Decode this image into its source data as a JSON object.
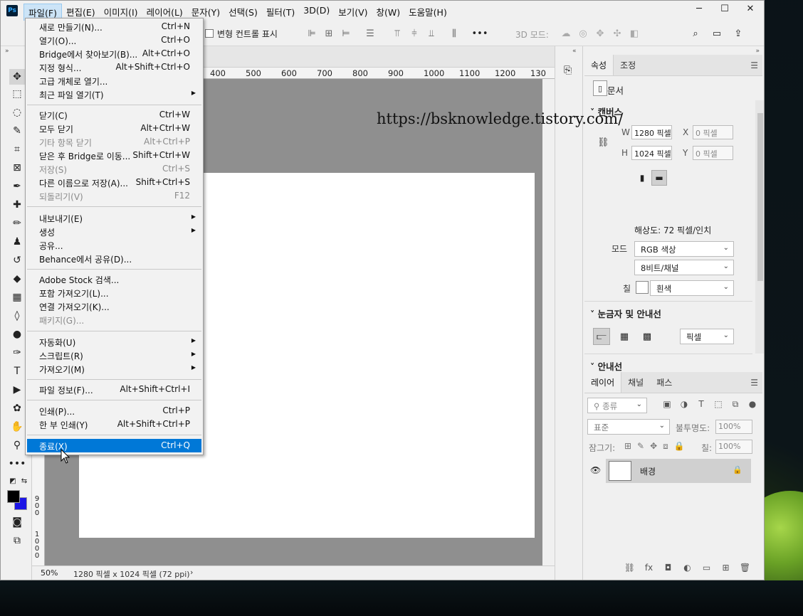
{
  "app": {
    "logo": "Ps"
  },
  "menubar": {
    "items": [
      "파일(F)",
      "편집(E)",
      "이미지(I)",
      "레이어(L)",
      "문자(Y)",
      "선택(S)",
      "필터(T)",
      "3D(D)",
      "보기(V)",
      "창(W)",
      "도움말(H)"
    ]
  },
  "window_controls": {
    "minimize": "─",
    "maximize": "☐",
    "close": "✕"
  },
  "options": {
    "transform_label": "변형 컨트롤 표시",
    "mode_3d": "3D 모드:"
  },
  "file_menu": {
    "items": [
      {
        "label": "새로 만들기(N)...",
        "shortcut": "Ctrl+N"
      },
      {
        "label": "열기(O)...",
        "shortcut": "Ctrl+O"
      },
      {
        "label": "Bridge에서 찾아보기(B)...",
        "shortcut": "Alt+Ctrl+O"
      },
      {
        "label": "지정 형식...",
        "shortcut": "Alt+Shift+Ctrl+O"
      },
      {
        "label": "고급 개체로 열기...",
        "shortcut": ""
      },
      {
        "label": "최근 파일 열기(T)",
        "shortcut": ""
      },
      {
        "label": "닫기(C)",
        "shortcut": "Ctrl+W"
      },
      {
        "label": "모두 닫기",
        "shortcut": "Alt+Ctrl+W"
      },
      {
        "label": "기타 항목 닫기",
        "shortcut": "Alt+Ctrl+P"
      },
      {
        "label": "닫은 후 Bridge로 이동...",
        "shortcut": "Shift+Ctrl+W"
      },
      {
        "label": "저장(S)",
        "shortcut": "Ctrl+S"
      },
      {
        "label": "다른 이름으로 저장(A)...",
        "shortcut": "Shift+Ctrl+S"
      },
      {
        "label": "되돌리기(V)",
        "shortcut": "F12"
      },
      {
        "label": "내보내기(E)",
        "shortcut": ""
      },
      {
        "label": "생성",
        "shortcut": ""
      },
      {
        "label": "공유...",
        "shortcut": ""
      },
      {
        "label": "Behance에서 공유(D)...",
        "shortcut": ""
      },
      {
        "label": "Adobe Stock 검색...",
        "shortcut": ""
      },
      {
        "label": "포함 가져오기(L)...",
        "shortcut": ""
      },
      {
        "label": "연결 가져오기(K)...",
        "shortcut": ""
      },
      {
        "label": "패키지(G)...",
        "shortcut": ""
      },
      {
        "label": "자동화(U)",
        "shortcut": ""
      },
      {
        "label": "스크립트(R)",
        "shortcut": ""
      },
      {
        "label": "가져오기(M)",
        "shortcut": ""
      },
      {
        "label": "파일 정보(F)...",
        "shortcut": "Alt+Shift+Ctrl+I"
      },
      {
        "label": "인쇄(P)...",
        "shortcut": "Ctrl+P"
      },
      {
        "label": "한 부 인쇄(Y)",
        "shortcut": "Alt+Shift+Ctrl+P"
      },
      {
        "label": "종료(X)",
        "shortcut": "Ctrl+Q"
      }
    ]
  },
  "ruler": {
    "h": [
      "400",
      "500",
      "600",
      "700",
      "800",
      "900",
      "1000",
      "1100",
      "1200",
      "130"
    ],
    "v": [
      "9",
      "0",
      "0",
      "1",
      "0",
      "0",
      "0",
      "1",
      "1",
      "0",
      "0"
    ]
  },
  "watermark": "https://bsknowledge.tistory.com/",
  "status": {
    "zoom": "50%",
    "info": "1280 픽셀 x 1024 픽셀 (72 ppi)",
    "arrow": "›"
  },
  "properties": {
    "tabs": [
      "속성",
      "조정"
    ],
    "doc_label": "문서",
    "canvas_title": "캔버스",
    "w_label": "W",
    "w_value": "1280 픽셀",
    "h_label": "H",
    "h_value": "1024 픽셀",
    "x_label": "X",
    "x_value": "0 픽셀",
    "y_label": "Y",
    "y_value": "0 픽셀",
    "resolution": "해상도: 72 픽셀/인치",
    "mode_label": "모드",
    "mode_value": "RGB 색상",
    "depth_value": "8비트/채널",
    "fill_label": "칠",
    "fill_value": "흰색",
    "rulers_title": "눈금자 및 안내선",
    "units_value": "픽셀",
    "guides_title": "안내선"
  },
  "layers": {
    "tabs": [
      "레이어",
      "채널",
      "패스"
    ],
    "filter_label": "종류",
    "blend_mode": "표준",
    "opacity_label": "불투명도:",
    "opacity_value": "100%",
    "lock_label": "잠그기:",
    "fill_label": "칠:",
    "fill_value": "100%",
    "layer_name": "배경"
  },
  "colors": {
    "foreground": "#000000",
    "background": "#1d16e6",
    "menu_highlight": "#0078d7"
  }
}
